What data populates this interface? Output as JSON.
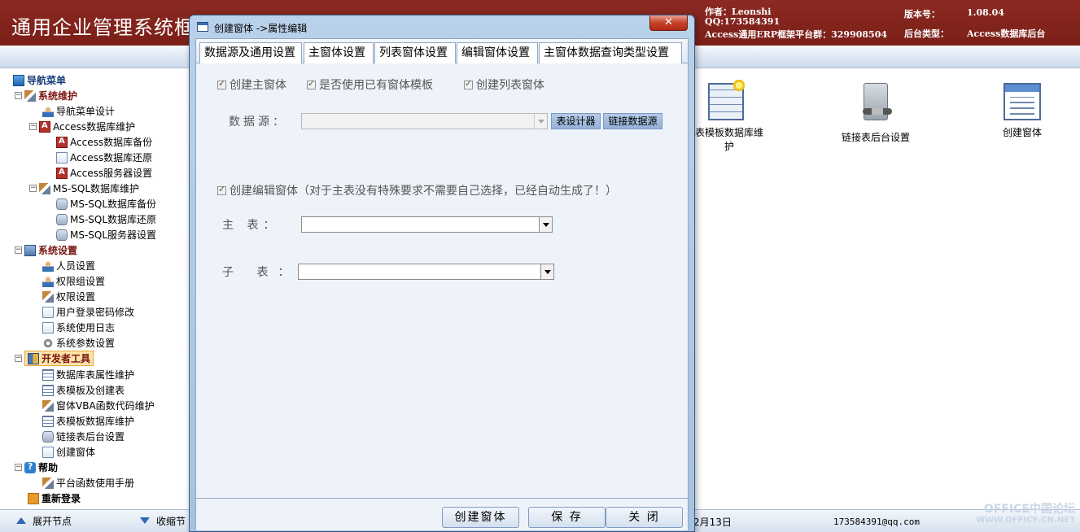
{
  "header": {
    "app_title": "通用企业管理系统框",
    "author_line": "作者：Leonshi",
    "qq_line": "QQ:173584391",
    "group_line": "Access通用ERP框架平台群：329908504",
    "version_label": "版本号：",
    "version_value": "1.08.04",
    "backend_label": "后台类型：",
    "backend_value": "Access数据库后台",
    "brand_color": "#7a1f18"
  },
  "nav": {
    "root": "导航菜单",
    "items": [
      {
        "label": "系统维护"
      },
      {
        "label": "导航菜单设计"
      },
      {
        "label": "Access数据库维护"
      },
      {
        "label": "Access数据库备份"
      },
      {
        "label": "Access数据库还原"
      },
      {
        "label": "Access服务器设置"
      },
      {
        "label": "MS-SQL数据库维护"
      },
      {
        "label": "MS-SQL数据库备份"
      },
      {
        "label": "MS-SQL数据库还原"
      },
      {
        "label": "MS-SQL服务器设置"
      },
      {
        "label": "系统设置"
      },
      {
        "label": "人员设置"
      },
      {
        "label": "权限组设置"
      },
      {
        "label": "权限设置"
      },
      {
        "label": "用户登录密码修改"
      },
      {
        "label": "系统使用日志"
      },
      {
        "label": "系统参数设置"
      },
      {
        "label": "开发者工具"
      },
      {
        "label": "数据库表属性维护"
      },
      {
        "label": "表模板及创建表"
      },
      {
        "label": "窗体VBA函数代码维护"
      },
      {
        "label": "表模板数据库维护"
      },
      {
        "label": "链接表后台设置"
      },
      {
        "label": "创建窗体"
      },
      {
        "label": "帮助"
      },
      {
        "label": "平台函数使用手册"
      },
      {
        "label": "重新登录"
      }
    ]
  },
  "background_tiles": {
    "table_model_label": "表模板数据库维护",
    "link_label": "链接表后台设置",
    "create_form_label": "创建窗体"
  },
  "statusbar": {
    "expand_label": "展开节点",
    "collapse_label": "收缩节",
    "date_fragment": "2月13日",
    "email": "173584391@qq.com"
  },
  "watermark": {
    "line1": "OFFICE中国论坛",
    "line2": "WWW.OFFICE-CN.NET"
  },
  "dialog": {
    "title": "创建窗体 ->属性编辑",
    "close_glyph": "✕",
    "tabs": [
      "数据源及通用设置",
      "主窗体设置",
      "列表窗体设置",
      "编辑窗体设置",
      "主窗体数据查询类型设置"
    ],
    "checkboxes": {
      "create_main": "创建主窗体",
      "use_template": "是否使用已有窗体模板",
      "create_list": "创建列表窗体",
      "create_edit": "创建编辑窗体（对于主表没有特殊要求不需要自己选择，已经自动生成了！）"
    },
    "datasource_label": "数据源：",
    "table_designer_btn": "表设计器",
    "link_datasource_btn": "链接数据源",
    "main_table_label": "主 表：",
    "sub_table_label": "子 表：",
    "buttons": {
      "create": "创建窗体",
      "save": "保 存",
      "close": "关 闭"
    }
  }
}
